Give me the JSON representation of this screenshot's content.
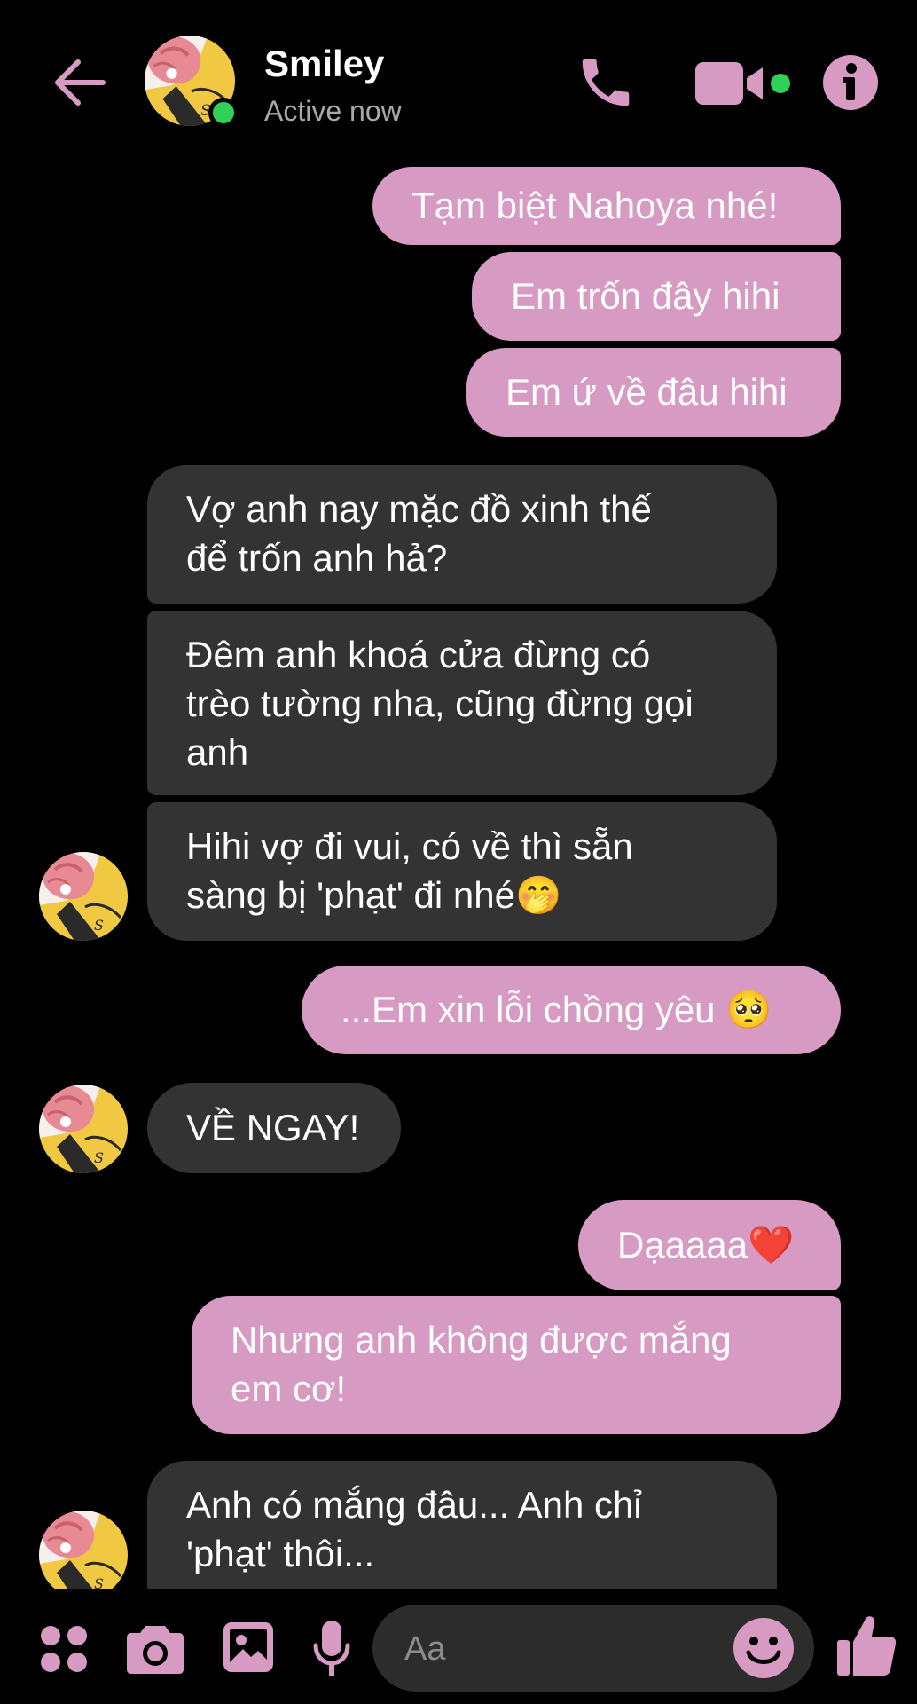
{
  "header": {
    "contact_name": "Smiley",
    "status": "Active now"
  },
  "messages": [
    {
      "id": 1,
      "direction": "outgoing",
      "text": "Tạm biệt Nahoya nhé!"
    },
    {
      "id": 2,
      "direction": "outgoing",
      "text": "Em trốn đây hihi"
    },
    {
      "id": 3,
      "direction": "outgoing",
      "text": "Em ứ về đâu hihi"
    },
    {
      "id": 4,
      "direction": "incoming",
      "text": "Vợ anh nay mặc đồ xinh thế\nđể trốn anh hả?"
    },
    {
      "id": 5,
      "direction": "incoming",
      "text": "Đêm anh khoá cửa đừng có\ntrèo tường nha, cũng đừng gọi\nanh"
    },
    {
      "id": 6,
      "direction": "incoming",
      "text": "Hihi vợ đi vui, có về thì sẵn\nsàng bị 'phạt' đi nhé🤭"
    },
    {
      "id": 7,
      "direction": "outgoing",
      "text": "...Em xin lỗi chồng yêu 🥺"
    },
    {
      "id": 8,
      "direction": "incoming",
      "text": "VỀ NGAY!"
    },
    {
      "id": 9,
      "direction": "outgoing",
      "text": "Dạaaaa❤️"
    },
    {
      "id": 10,
      "direction": "outgoing",
      "text": "Nhưng anh không được mắng\nem cơ!"
    },
    {
      "id": 11,
      "direction": "incoming",
      "text": "Anh có mắng đâu... Anh chỉ\n'phạt' thôi..."
    }
  ],
  "composer": {
    "placeholder": "Aa"
  },
  "colors": {
    "accent": "#d69ac3",
    "outgoing_bubble": "#d69ac3",
    "incoming_bubble": "#333333",
    "background": "#000000",
    "online": "#2fd058"
  },
  "icons": {
    "back": "arrow-left-icon",
    "phone": "phone-icon",
    "video": "video-camera-icon",
    "info": "info-icon",
    "apps": "apps-grid-icon",
    "camera": "camera-icon",
    "gallery": "image-icon",
    "mic": "microphone-icon",
    "emoji": "smiley-icon",
    "like": "thumbs-up-icon"
  }
}
